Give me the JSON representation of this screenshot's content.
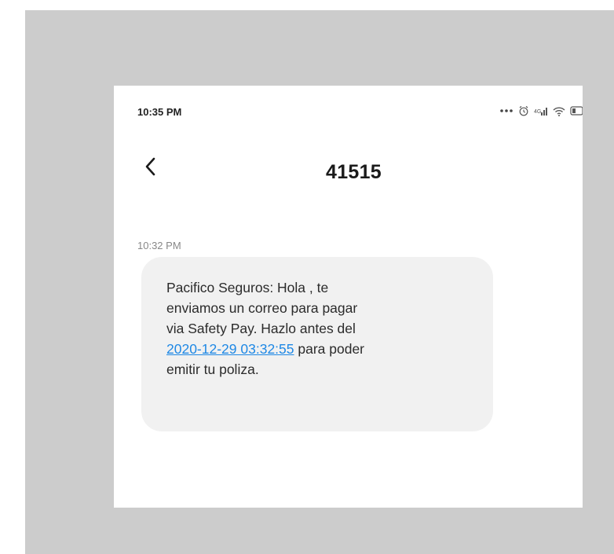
{
  "status_bar": {
    "time": "10:35 PM",
    "icons": [
      "more-dots-icon",
      "alarm-icon",
      "signal-icon",
      "wifi-icon",
      "battery-icon"
    ]
  },
  "header": {
    "title": "41515",
    "back_icon": "chevron-left-icon"
  },
  "message": {
    "timestamp": "10:32 PM",
    "line1": "Pacifico Seguros: Hola , te",
    "line2": "enviamos un correo para pagar",
    "line3": "via Safety Pay. Hazlo antes del",
    "link_text": "2020-12-29 03:32:55",
    "after_link": " para poder",
    "line5": "emitir tu poliza."
  },
  "colors": {
    "frame": "#cccccc",
    "bubble": "#f1f1f1",
    "link": "#1e88e5",
    "text": "#2b2b2b"
  }
}
